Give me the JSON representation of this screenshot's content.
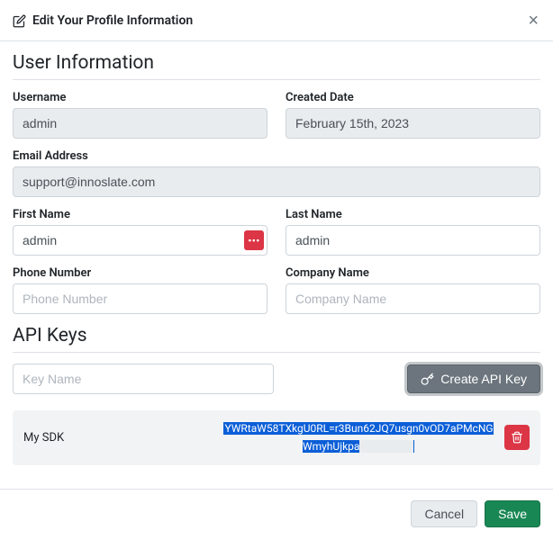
{
  "header": {
    "title": "Edit Your Profile Information"
  },
  "userInfo": {
    "heading": "User Information",
    "labels": {
      "username": "Username",
      "createdDate": "Created Date",
      "email": "Email Address",
      "firstName": "First Name",
      "lastName": "Last Name",
      "phone": "Phone Number",
      "company": "Company Name"
    },
    "values": {
      "username": "admin",
      "createdDate": "February 15th, 2023",
      "email": "support@innoslate.com",
      "firstName": "admin",
      "lastName": "admin",
      "phone": "",
      "company": ""
    },
    "placeholders": {
      "phone": "Phone Number",
      "company": "Company Name"
    }
  },
  "apiKeys": {
    "heading": "API Keys",
    "keyNamePlaceholder": "Key Name",
    "createButton": "Create API Key",
    "items": [
      {
        "name": "My SDK",
        "value": "YWRtaW58TXkgU0RL=r3Bun62JQ7usgn0vOD7aPMcNGWmyhUjkpa"
      }
    ]
  },
  "footer": {
    "cancel": "Cancel",
    "save": "Save"
  }
}
